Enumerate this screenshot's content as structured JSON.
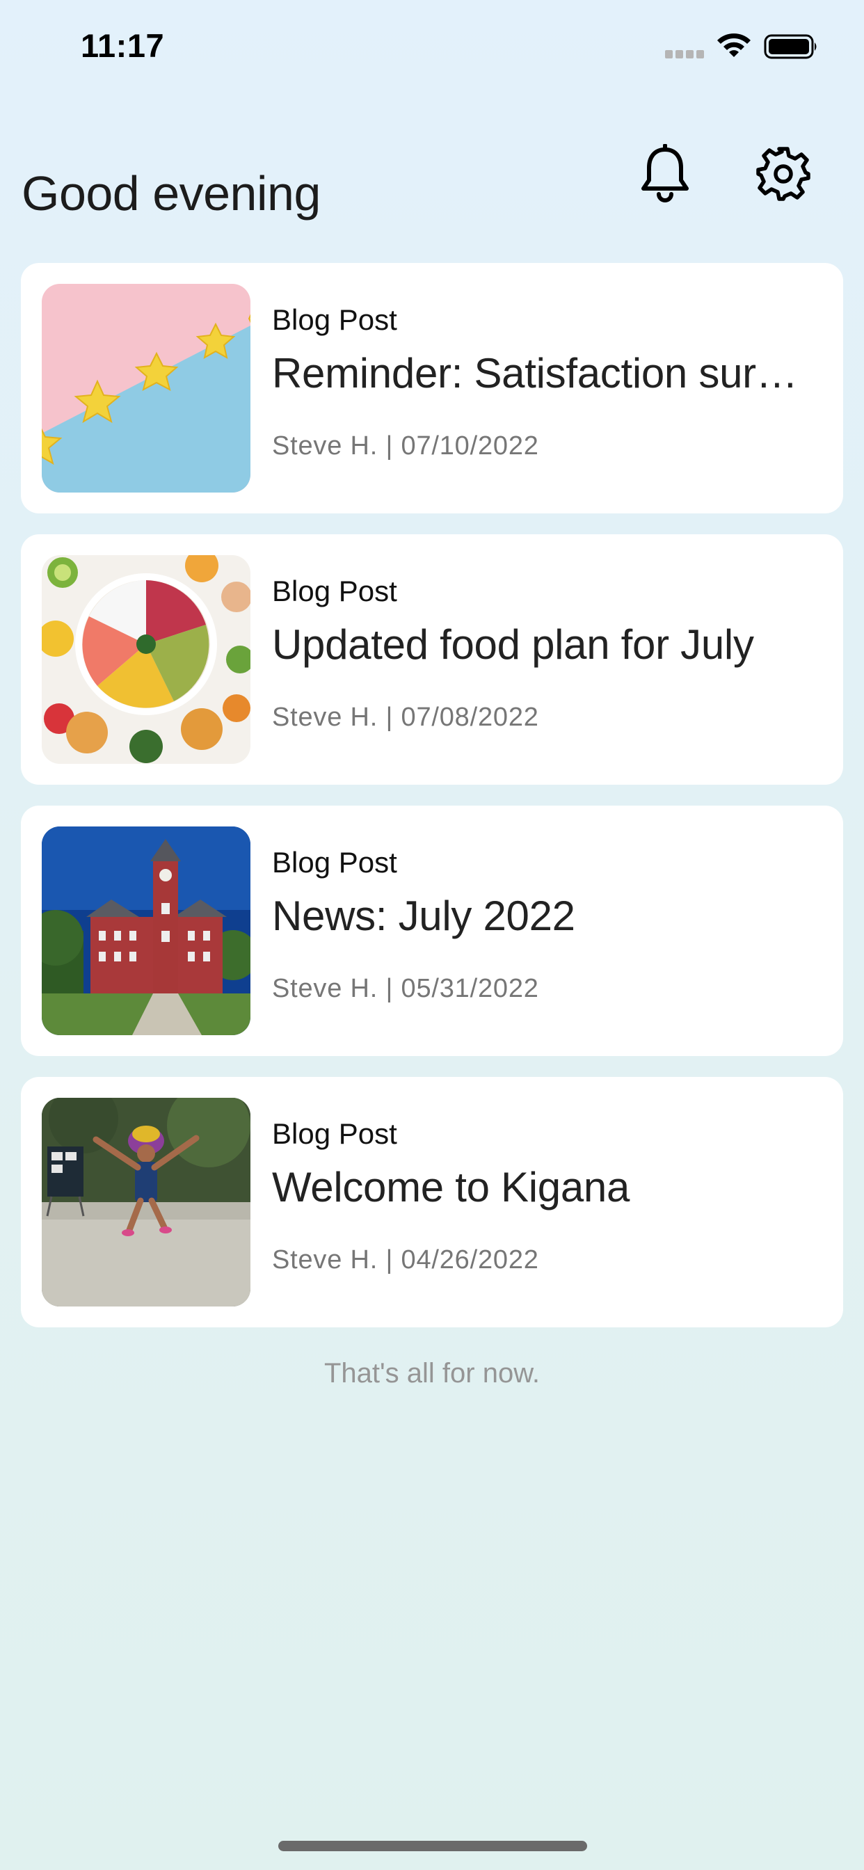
{
  "status_bar": {
    "time": "11:17"
  },
  "header": {
    "greeting": "Good evening",
    "bell_icon": "bell-icon",
    "gear_icon": "gear-icon"
  },
  "posts": [
    {
      "category": "Blog Post",
      "title": "Reminder: Satisfaction survey",
      "meta": "Steve H. | 07/10/2022",
      "image": "stars-on-pink-and-blue"
    },
    {
      "category": "Blog Post",
      "title": "Updated food plan for July",
      "meta": "Steve H. | 07/08/2022",
      "image": "fruit-bowl-and-muffins"
    },
    {
      "category": "Blog Post",
      "title": "News: July 2022",
      "meta": "Steve H. | 05/31/2022",
      "image": "brick-clock-tower-building"
    },
    {
      "category": "Blog Post",
      "title": "Welcome to Kigana",
      "meta": "Steve H. | 04/26/2022",
      "image": "child-jumping-outdoors"
    }
  ],
  "footer": {
    "end_message": "That's all for now."
  },
  "colors": {
    "background_top": "#e3f1fb",
    "background_bottom": "#e0f1ef",
    "card": "#ffffff",
    "meta_text": "#767676",
    "end_text": "#959595"
  }
}
